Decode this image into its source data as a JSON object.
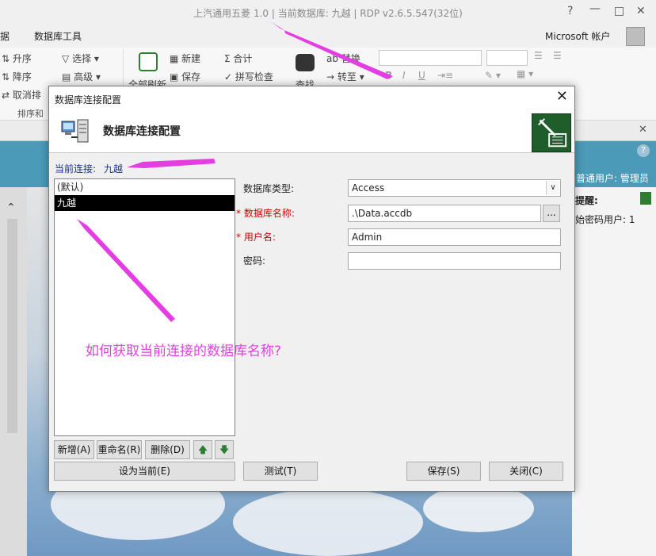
{
  "app": {
    "title": "上汽通用五菱 1.0 | 当前数据库: 九越 | RDP v2.6.5.547(32位)",
    "menu": [
      "据",
      "数据库工具"
    ],
    "account": "Microsoft 帐户",
    "ribbon": {
      "sort_asc": "升序",
      "sort_desc": "降序",
      "cancel_sort": "取消排",
      "sort_group": "排序和",
      "select": "选择",
      "advanced": "高级",
      "refresh_all": "全部刷新",
      "new": "新建",
      "save": "保存",
      "total": "合计",
      "spell_check": "拼写检查",
      "find": "查找",
      "replace": "替换",
      "goto": "转至"
    },
    "right_panel": {
      "user_info": "普通用户: 管理员",
      "reminder": "提醒:",
      "initial_password": "始密码用户: 1"
    }
  },
  "dialog": {
    "window_title": "数据库连接配置",
    "header_title": "数据库连接配置",
    "current_connection_label": "当前连接:",
    "current_connection_value": "九越",
    "connections": [
      {
        "name": "(默认)",
        "selected": false
      },
      {
        "name": "九越",
        "selected": true
      }
    ],
    "buttons": {
      "new": "新增(A)",
      "rename": "重命名(R)",
      "delete": "删除(D)",
      "set_current": "设为当前(E)",
      "test": "测试(T)",
      "save": "保存(S)",
      "close": "关闭(C)",
      "browse": "..."
    },
    "form": {
      "db_type_label": "数据库类型:",
      "db_type_value": "Access",
      "db_name_label": "数据库名称:",
      "db_name_value": ".\\Data.accdb",
      "username_label": "用户名:",
      "username_value": "Admin",
      "password_label": "密码:",
      "password_value": "",
      "required_mark": "*"
    }
  },
  "annotation": {
    "question": "如何获取当前连接的数据库名称?",
    "color": "#e040e0"
  }
}
